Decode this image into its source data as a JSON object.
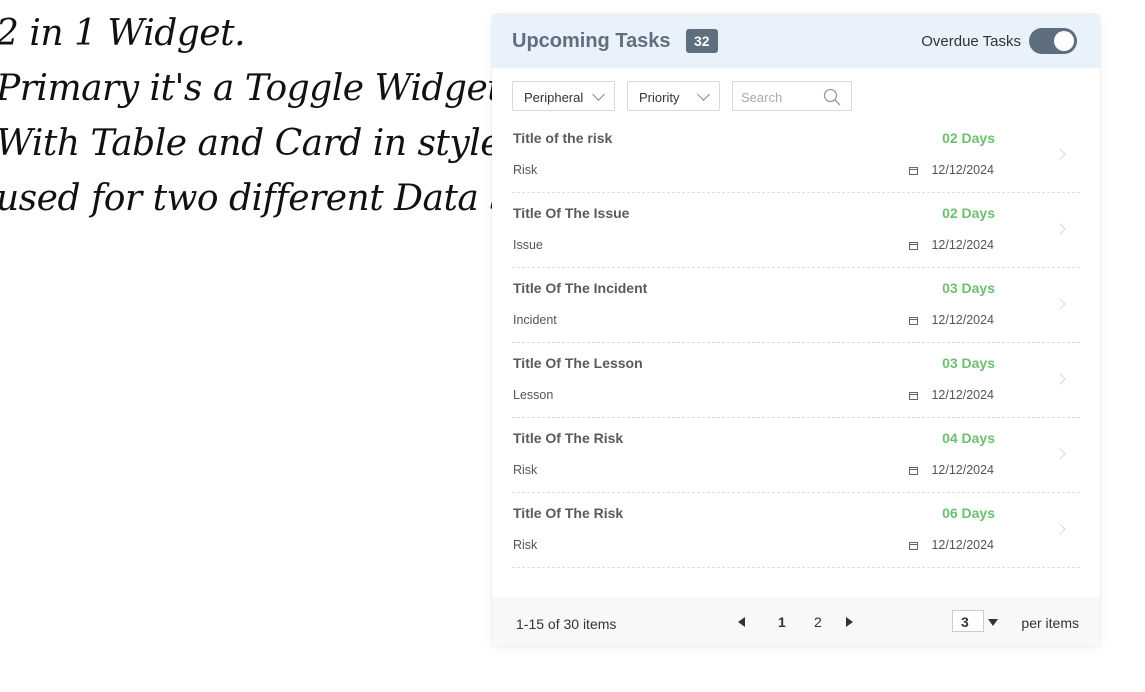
{
  "note": {
    "lines": [
      "2 in 1 Widget.",
      "Primary it's a Toggle Widget,",
      "With Table and Card in style",
      "used for two different Data Set"
    ]
  },
  "widget": {
    "title": "Upcoming Tasks",
    "count": "32",
    "toggle_label": "Overdue Tasks",
    "toggle_on": true,
    "colors": {
      "header_bg": "#e9f1fb",
      "badge_bg": "#5e6e7e",
      "days_green": "#6cbf6e"
    }
  },
  "filters": {
    "peripheral": "Peripheral",
    "priority": "Priority",
    "search_placeholder": "Search"
  },
  "rows": [
    {
      "title": "Title of the risk",
      "days": "02 Days",
      "type": "Risk",
      "date": "12/12/2024"
    },
    {
      "title": "Title Of The Issue",
      "days": "02 Days",
      "type": "Issue",
      "date": "12/12/2024"
    },
    {
      "title": "Title Of The Incident",
      "days": "03 Days",
      "type": "Incident",
      "date": "12/12/2024"
    },
    {
      "title": "Title Of The Lesson",
      "days": "03 Days",
      "type": "Lesson",
      "date": "12/12/2024"
    },
    {
      "title": "Title Of The Risk",
      "days": "04 Days",
      "type": "Risk",
      "date": "12/12/2024"
    },
    {
      "title": "Title Of The Risk",
      "days": "06 Days",
      "type": "Risk",
      "date": "12/12/2024"
    }
  ],
  "footer": {
    "range": "1-15 of 30 items",
    "pages": [
      "1",
      "2"
    ],
    "current_page": "1",
    "per_page": "3",
    "per_items_label": "per items"
  }
}
